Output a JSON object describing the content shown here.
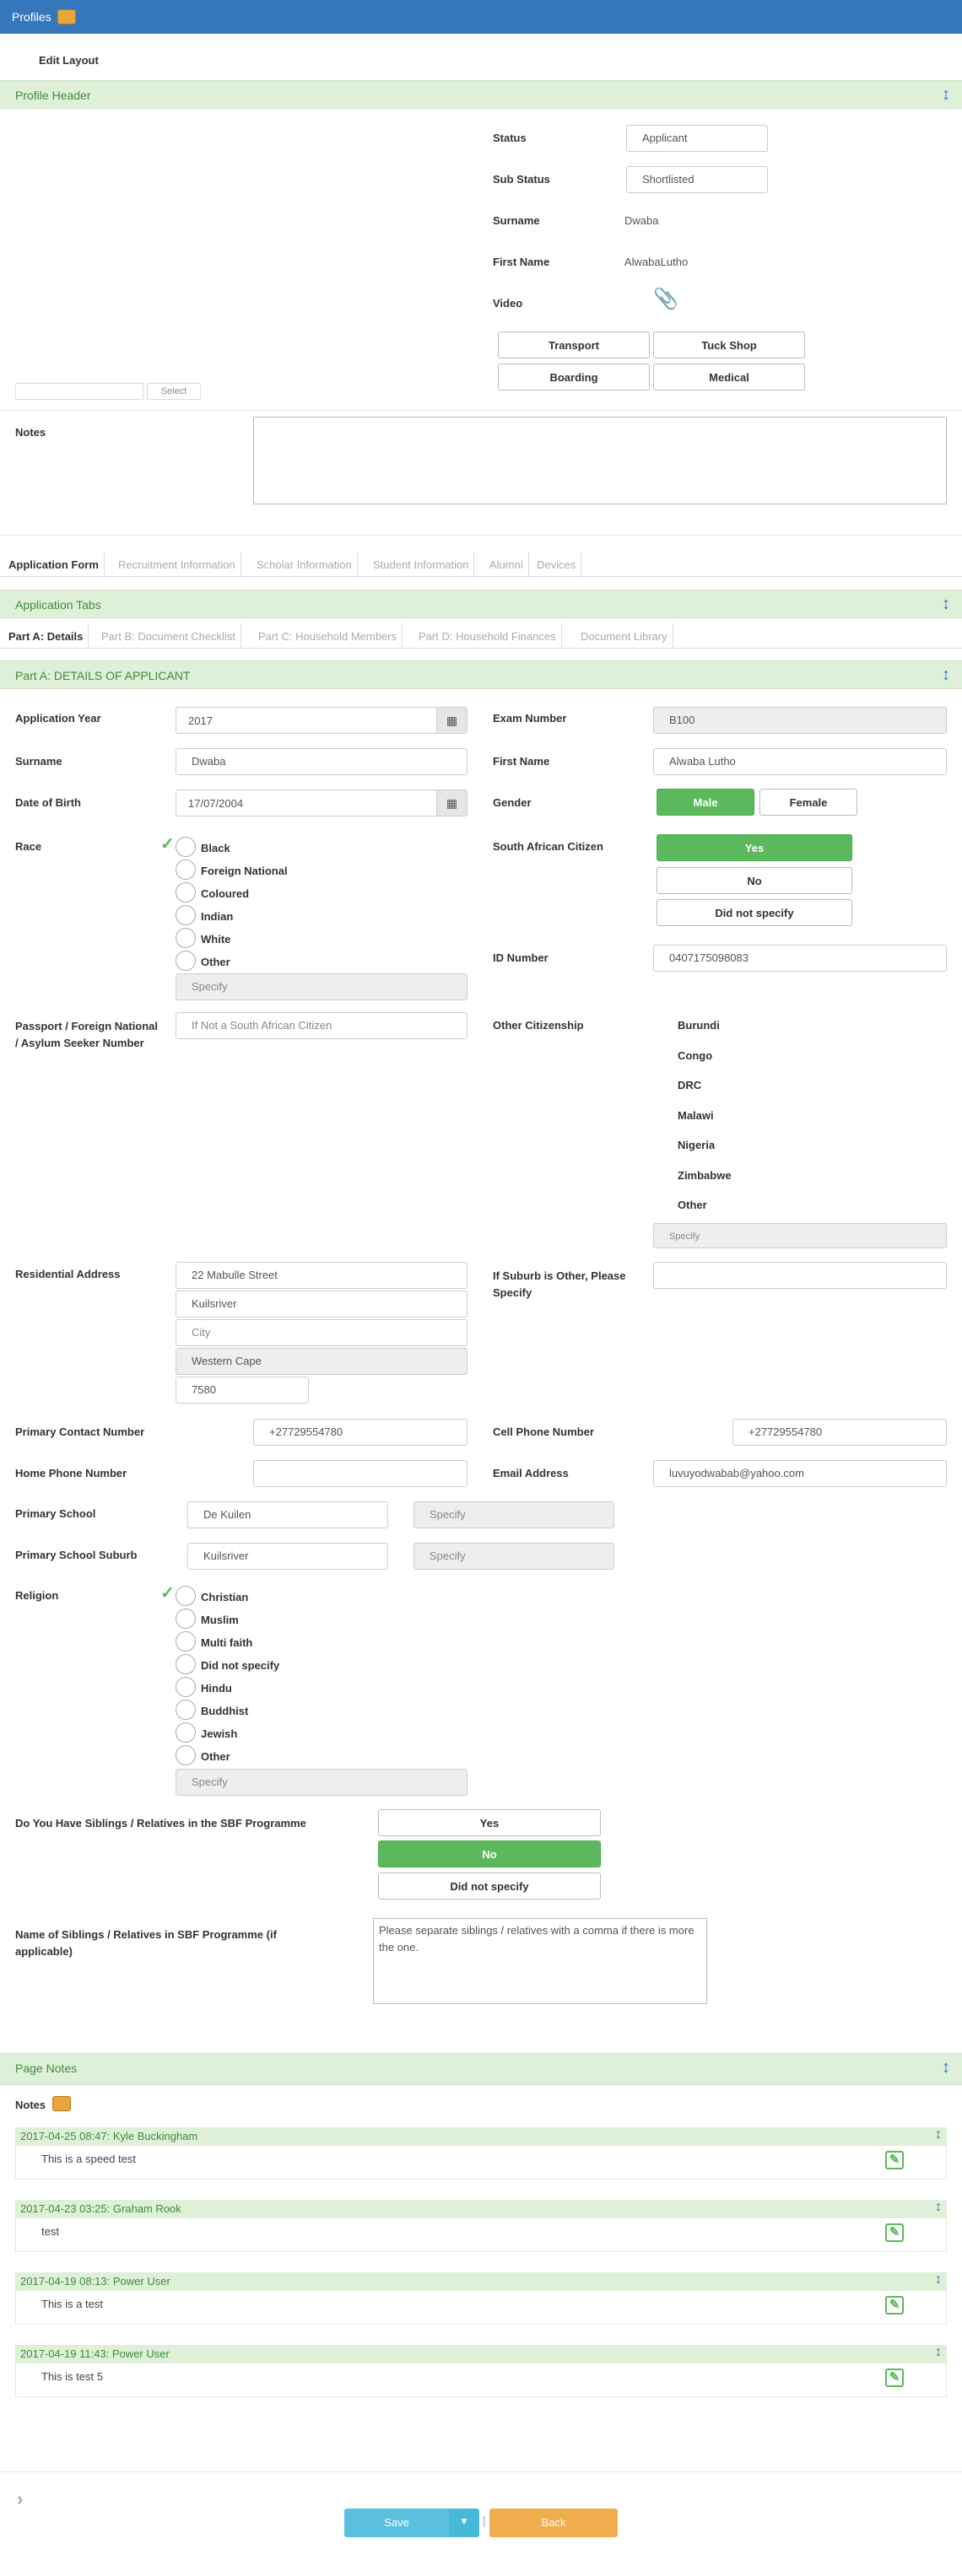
{
  "app": {
    "title": "Profiles",
    "edit_layout": "Edit Layout"
  },
  "profile_header": {
    "section_title": "Profile Header",
    "status_label": "Status",
    "status_value": "Applicant",
    "sub_status_label": "Sub Status",
    "sub_status_value": "Shortlisted",
    "surname_label": "Surname",
    "surname_value": "Dwaba",
    "first_name_label": "First Name",
    "first_name_value": "AlwabaLutho",
    "video_label": "Video",
    "buttons": [
      "Transport",
      "Tuck Shop",
      "Boarding",
      "Medical"
    ],
    "select_button": "Select",
    "notes_label": "Notes"
  },
  "main_tabs": [
    "Application Form",
    "Recruitment Information",
    "Scholar Information",
    "Student Information",
    "Alumni",
    "Devices"
  ],
  "application_tabs": {
    "section_title": "Application Tabs",
    "tabs": [
      "Part A: Details",
      "Part B: Document Checklist",
      "Part C: Household Members",
      "Part D: Household Finances",
      "Document Library"
    ]
  },
  "part_a": {
    "section_title": "Part A: DETAILS OF APPLICANT",
    "application_year_label": "Application Year",
    "application_year_value": "2017",
    "exam_number_label": "Exam Number",
    "exam_number_value": "B100",
    "surname_label": "Surname",
    "surname_value": "Dwaba",
    "first_name_label": "First Name",
    "first_name_value": "Alwaba Lutho",
    "dob_label": "Date of Birth",
    "dob_value": "17/07/2004",
    "gender_label": "Gender",
    "gender_male": "Male",
    "gender_female": "Female",
    "race_label": "Race",
    "race_options": [
      "Black",
      "Foreign National",
      "Coloured",
      "Indian",
      "White",
      "Other"
    ],
    "race_specify": "Specify",
    "sa_citizen_label": "South African Citizen",
    "sa_citizen_options": [
      "Yes",
      "No",
      "Did not specify"
    ],
    "id_number_label": "ID Number",
    "id_number_value": "0407175098083",
    "passport_label": "Passport / Foreign National / Asylum Seeker Number",
    "passport_placeholder": "If Not a South African Citizen",
    "other_citizenship_label": "Other Citizenship",
    "other_citizenship_options": [
      "Burundi",
      "Congo",
      "DRC",
      "Malawi",
      "Nigeria",
      "Zimbabwe",
      "Other"
    ],
    "other_citizenship_specify": "Specify",
    "res_address_label": "Residential Address",
    "res_address": [
      "22 Mabulle Street",
      "Kuilsriver",
      "City",
      "Western Cape",
      "7580"
    ],
    "suburb_other_label": "If Suburb is Other, Please Specify",
    "primary_contact_label": "Primary Contact Number",
    "primary_contact_value": "+27729554780",
    "cell_phone_label": "Cell Phone Number",
    "cell_phone_value": "+27729554780",
    "home_phone_label": "Home Phone Number",
    "email_label": "Email Address",
    "email_value": "luvuyodwabab@yahoo.com",
    "primary_school_label": "Primary School",
    "primary_school_value": "De Kuilen",
    "primary_school_specify": "Specify",
    "primary_school_suburb_label": "Primary School Suburb",
    "primary_school_suburb_value": "Kuilsriver",
    "primary_school_suburb_specify": "Specify",
    "religion_label": "Religion",
    "religion_options": [
      "Christian",
      "Muslim",
      "Multi faith",
      "Did not specify",
      "Hindu",
      "Buddhist",
      "Jewish",
      "Other"
    ],
    "religion_specify": "Specify",
    "siblings_label": "Do You Have Siblings / Relatives in the SBF Programme",
    "siblings_options": [
      "Yes",
      "No",
      "Did not specify"
    ],
    "siblings_names_label": "Name of Siblings / Relatives in SBF Programme (if applicable)",
    "siblings_names_placeholder": "Please separate siblings / relatives with a comma if there is more the one."
  },
  "page_notes": {
    "section_title": "Page Notes",
    "notes_label": "Notes",
    "notes": [
      {
        "header": "2017-04-25 08:47: Kyle Buckingham",
        "text": "This is a speed test"
      },
      {
        "header": "2017-04-23 03:25: Graham Rook",
        "text": "test"
      },
      {
        "header": "2017-04-19 08:13: Power User",
        "text": "This is a test"
      },
      {
        "header": "2017-04-19 11:43: Power User",
        "text": "This is test 5"
      }
    ]
  },
  "footer": {
    "save": "Save",
    "back": "Back"
  },
  "colors": {
    "topbar": "#3577bb",
    "section": "#dff0d8",
    "green": "#5cb85c",
    "save": "#5bc0de",
    "back": "#f0ad4e"
  }
}
